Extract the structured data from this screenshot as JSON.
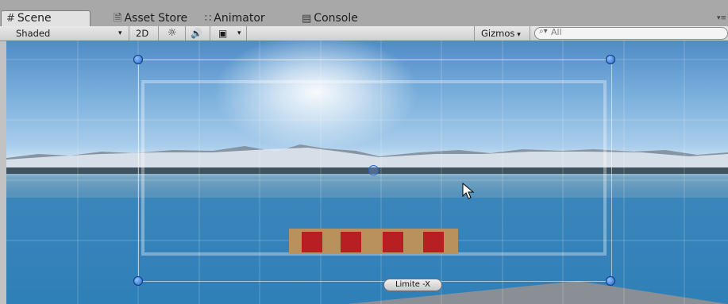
{
  "tabs": [
    {
      "label": "Scene",
      "icon": "grid-icon"
    },
    {
      "label": "Asset Store",
      "icon": "store-icon"
    },
    {
      "label": "Animator",
      "icon": "animator-icon"
    },
    {
      "label": "Console",
      "icon": "console-icon"
    }
  ],
  "toolbar": {
    "shading_mode": "Shaded",
    "mode_2d": "2D",
    "gizmos_label": "Gizmos",
    "search_placeholder": "All"
  },
  "scene": {
    "limit_label": "Limite -X"
  }
}
